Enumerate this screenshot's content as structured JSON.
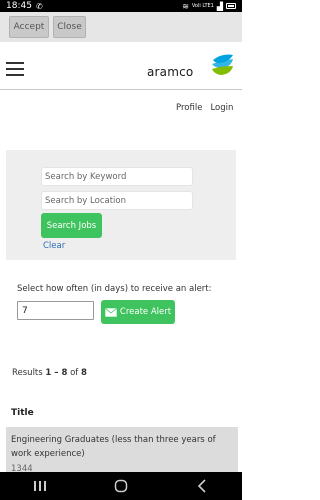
{
  "status": {
    "time": "18:45",
    "left_icon": "whatsapp-icon",
    "network": "Voli LTE1",
    "signal": "signal-icon",
    "battery": "battery-icon"
  },
  "cookie": {
    "accept_label": "Accept",
    "close_label": "Close"
  },
  "header": {
    "logo_text": "aramco",
    "menu_icon": "hamburger-icon"
  },
  "nav": {
    "profile": "Profile",
    "login": "Login"
  },
  "search": {
    "keyword_placeholder": "Search by Keyword",
    "location_placeholder": "Search by Location",
    "search_label": "Search Jobs",
    "clear_label": "Clear"
  },
  "alert": {
    "label": "Select how often (in days) to receive an alert:",
    "days_value": "7",
    "create_label": "Create Alert"
  },
  "results": {
    "prefix": "Results ",
    "range": "1 – 8",
    "of": " of ",
    "total": "8"
  },
  "table": {
    "column_title": "Title",
    "rows": [
      {
        "title": "Engineering Graduates (less than three years of work experience)",
        "id": "1344"
      }
    ]
  },
  "colors": {
    "accent_green": "#3fc35f",
    "link_blue": "#2e6db4"
  }
}
